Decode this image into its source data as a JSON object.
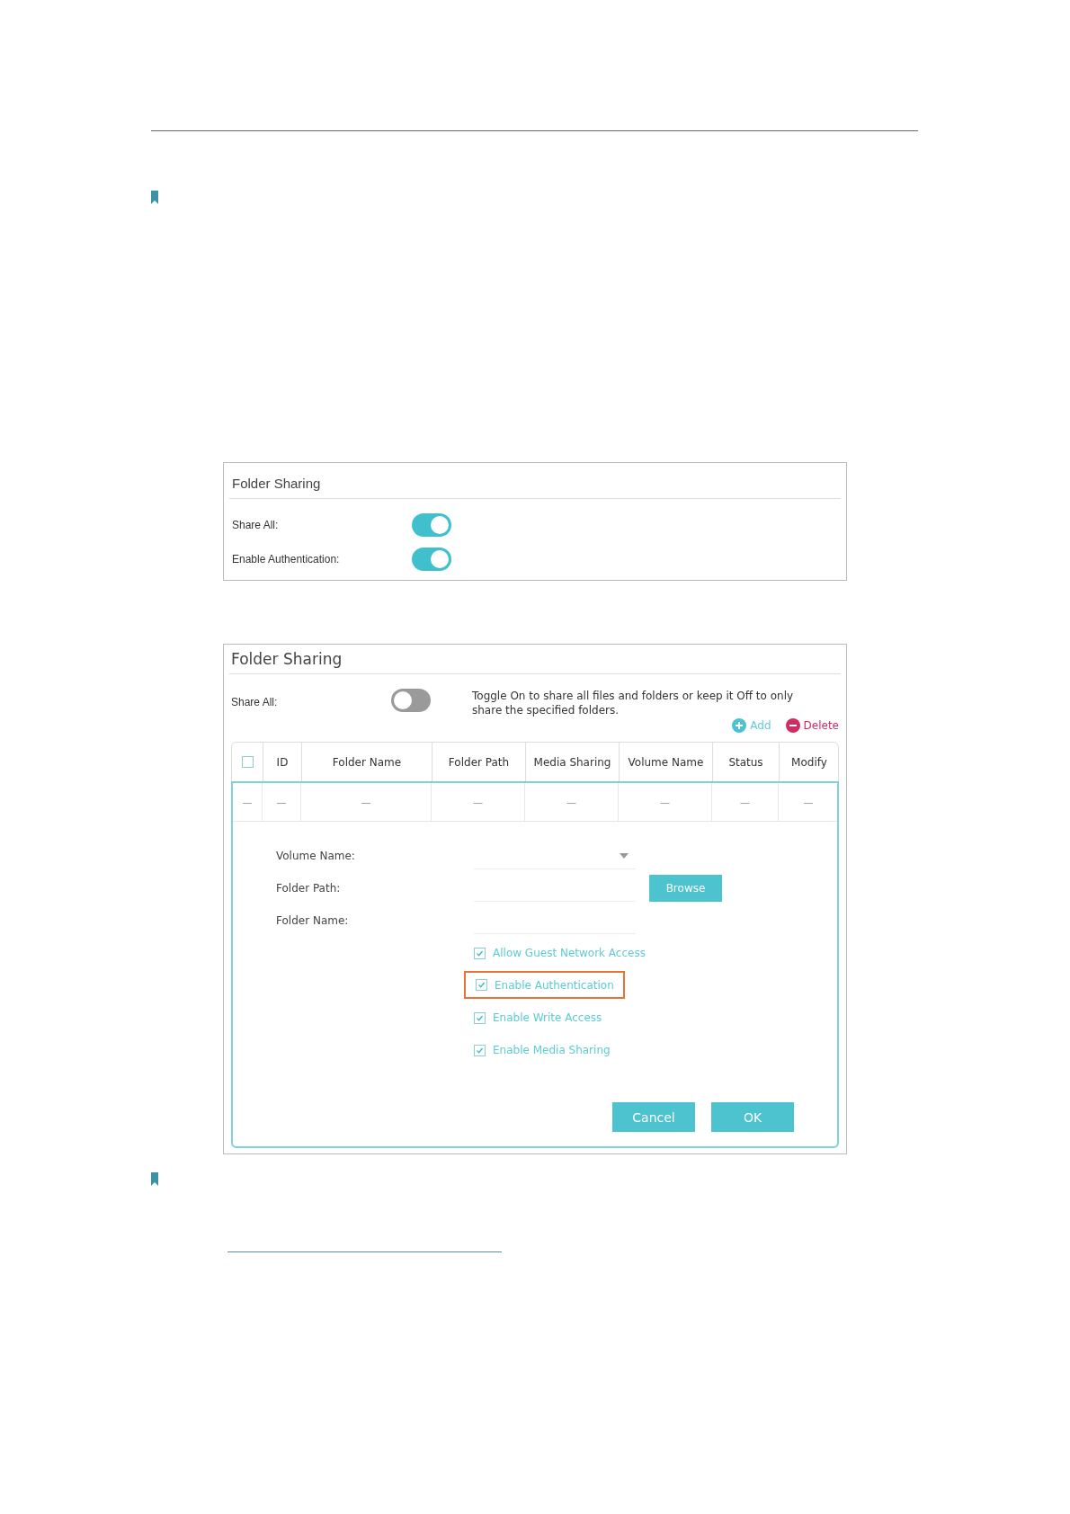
{
  "summary_panel": {
    "title": "Folder Sharing",
    "toggles": [
      {
        "label": "Share All:",
        "on": true
      },
      {
        "label": "Enable Authentication:",
        "on": true
      }
    ]
  },
  "edit_panel": {
    "title": "Folder Sharing",
    "share_all": {
      "label": "Share All:",
      "on": false
    },
    "hint": "Toggle On to share all files and folders or keep it Off to only share the specified folders.",
    "actions": [
      {
        "kind": "add",
        "label": "Add"
      },
      {
        "kind": "delete",
        "label": "Delete"
      }
    ],
    "table": {
      "select_all_checked": false,
      "columns": [
        "ID",
        "Folder Name",
        "Folder Path",
        "Media Sharing",
        "Volume Name",
        "Status",
        "Modify"
      ],
      "row": [
        "—",
        "—",
        "—",
        "—",
        "—",
        "—",
        "—",
        "—"
      ]
    },
    "form": {
      "fields": [
        {
          "kind": "select",
          "label": "Volume Name:"
        },
        {
          "kind": "text",
          "label": "Folder Path:",
          "button": "Browse"
        },
        {
          "kind": "text",
          "label": "Folder Name:"
        }
      ],
      "options": [
        {
          "label": "Allow Guest Network Access",
          "checked": true,
          "highlighted": false
        },
        {
          "label": "Enable Authentication",
          "checked": true,
          "highlighted": true
        },
        {
          "label": "Enable Write Access",
          "checked": true,
          "highlighted": false
        },
        {
          "label": "Enable Media Sharing",
          "checked": true,
          "highlighted": false
        }
      ],
      "buttons": [
        "Cancel",
        "OK"
      ]
    }
  }
}
